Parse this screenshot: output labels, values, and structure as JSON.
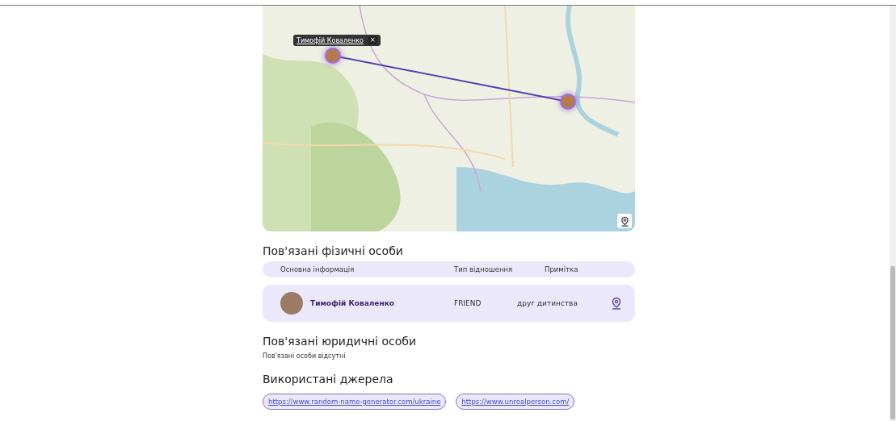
{
  "map": {
    "kind": "picture",
    "popup": {
      "name": "Тимофій Коваленко",
      "close": "×"
    },
    "markers": [
      {
        "kind": "avatar"
      },
      {
        "kind": "avatar"
      }
    ]
  },
  "persons": {
    "title": "Пов'язані фізичні особи",
    "columns": [
      "Основна інформація",
      "Тип відношення",
      "Примітка"
    ],
    "rows": [
      {
        "name": "Тимофій Коваленко",
        "relation": "FRIEND",
        "note": "друг дитинства"
      }
    ]
  },
  "legal": {
    "title": "Пов'язані юридичні особи",
    "empty": "Пов'язані особи відсутні"
  },
  "sources": {
    "title": "Використані джерела",
    "links": [
      "https://www.random-name-generator.com/ukraine",
      "https://www.unrealperson.com/"
    ]
  }
}
